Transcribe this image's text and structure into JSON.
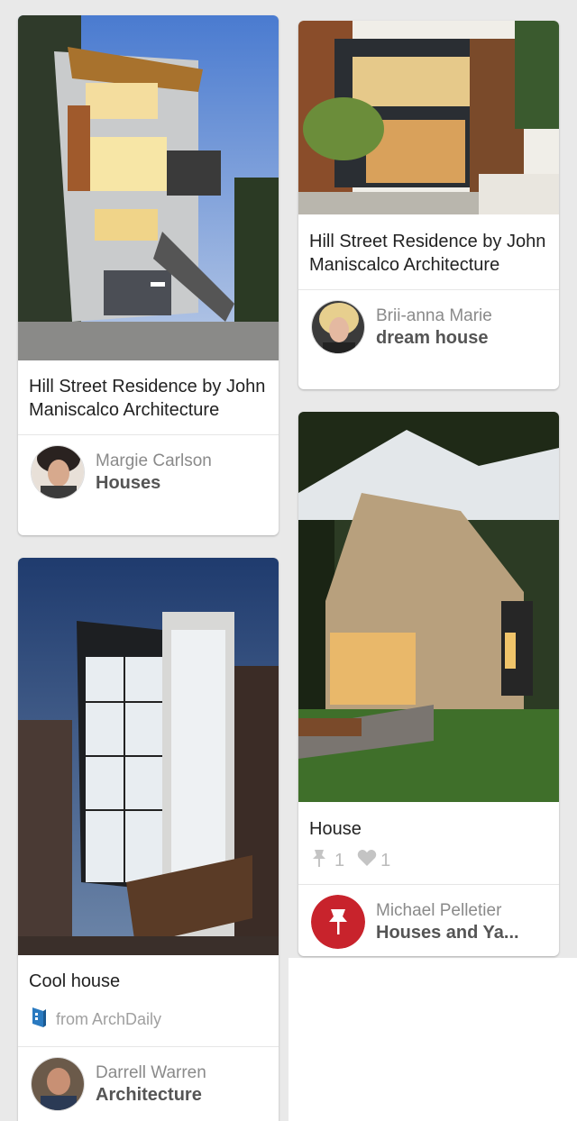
{
  "pins": [
    {
      "description": "Hill Street Residence by John Maniscalco Architecture",
      "user": "Margie Carlson",
      "board": "Houses"
    },
    {
      "description": "Cool house",
      "source": "from ArchDaily",
      "user": "Darrell Warren",
      "board": "Architecture"
    },
    {
      "description": "Hill Street Residence by John Maniscalco Architecture",
      "user": "Brii-anna Marie",
      "board": "dream house"
    },
    {
      "description": "House",
      "repins": "1",
      "likes": "1",
      "user": "Michael Pelletier",
      "board": "Houses and Ya..."
    }
  ]
}
